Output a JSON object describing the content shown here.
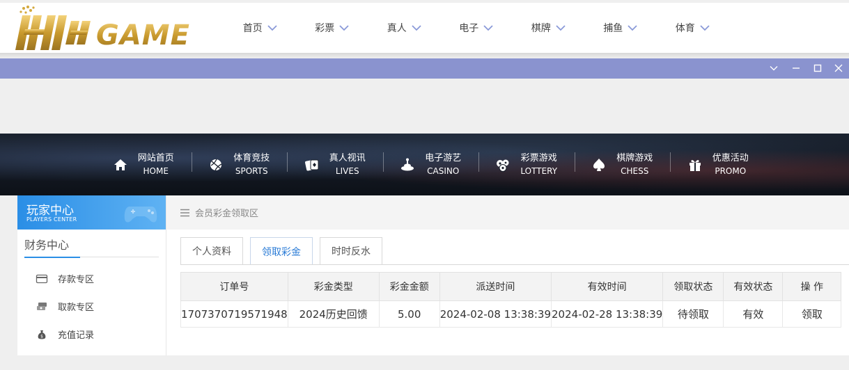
{
  "brand": {
    "logo_text": "HH GAME"
  },
  "top_nav": [
    {
      "label": "首页"
    },
    {
      "label": "彩票"
    },
    {
      "label": "真人"
    },
    {
      "label": "电子"
    },
    {
      "label": "棋牌"
    },
    {
      "label": "捕鱼"
    },
    {
      "label": "体育"
    }
  ],
  "main_nav": [
    {
      "cn": "网站首页",
      "en": "HOME",
      "icon": "home-icon"
    },
    {
      "cn": "体育竞技",
      "en": "SPORTS",
      "icon": "ball-icon"
    },
    {
      "cn": "真人视讯",
      "en": "LIVES",
      "icon": "cards-icon"
    },
    {
      "cn": "电子游艺",
      "en": "CASINO",
      "icon": "slot-icon"
    },
    {
      "cn": "彩票游戏",
      "en": "LOTTERY",
      "icon": "lottery-balls-icon"
    },
    {
      "cn": "棋牌游戏",
      "en": "CHESS",
      "icon": "spade-icon"
    },
    {
      "cn": "优惠活动",
      "en": "PROMO",
      "icon": "gift-icon"
    }
  ],
  "sidebar": {
    "title_cn": "玩家中心",
    "title_en": "PLAYERS CENTER",
    "section": "财务中心",
    "items": [
      {
        "label": "存款专区",
        "icon": "card-icon"
      },
      {
        "label": "取款专区",
        "icon": "cash-icon"
      },
      {
        "label": "充值记录",
        "icon": "money-bag-icon"
      }
    ]
  },
  "breadcrumb": "会员彩金领取区",
  "tabs": [
    {
      "label": "个人资料",
      "active": false
    },
    {
      "label": "领取彩金",
      "active": true
    },
    {
      "label": "时时反水",
      "active": false
    }
  ],
  "table": {
    "headers": [
      "订单号",
      "彩金类型",
      "彩金金额",
      "派送时间",
      "有效时间",
      "领取状态",
      "有效状态",
      "操 作"
    ],
    "rows": [
      [
        "1707370719571948",
        "2024历史回馈",
        "5.00",
        "2024-02-08 13:38:39",
        "2024-02-28 13:38:39",
        "待领取",
        "有效",
        "领取"
      ]
    ]
  },
  "colors": {
    "accent": "#2a7bd6",
    "titlebar": "#8a93cf",
    "logo_gold": "#c9a13a"
  }
}
